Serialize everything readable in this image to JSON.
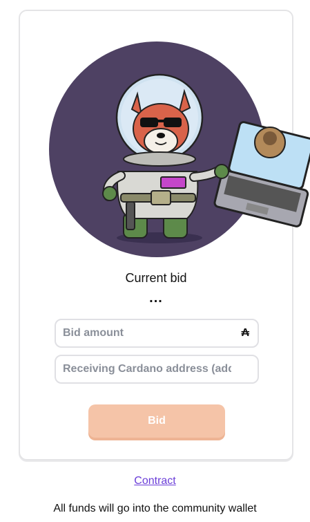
{
  "auction": {
    "current_bid_label": "Current bid",
    "current_bid_value": "..."
  },
  "form": {
    "amount_placeholder": "Bid amount",
    "currency_symbol": "₳",
    "address_placeholder": "Receiving Cardano address (addr...)",
    "submit_label": "Bid"
  },
  "footer": {
    "contract_link": "Contract",
    "note": "All funds will go into the community wallet"
  },
  "colors": {
    "button_bg": "#f5c4a8",
    "link": "#6a3dd8",
    "hero_circle": "#4e4163"
  }
}
